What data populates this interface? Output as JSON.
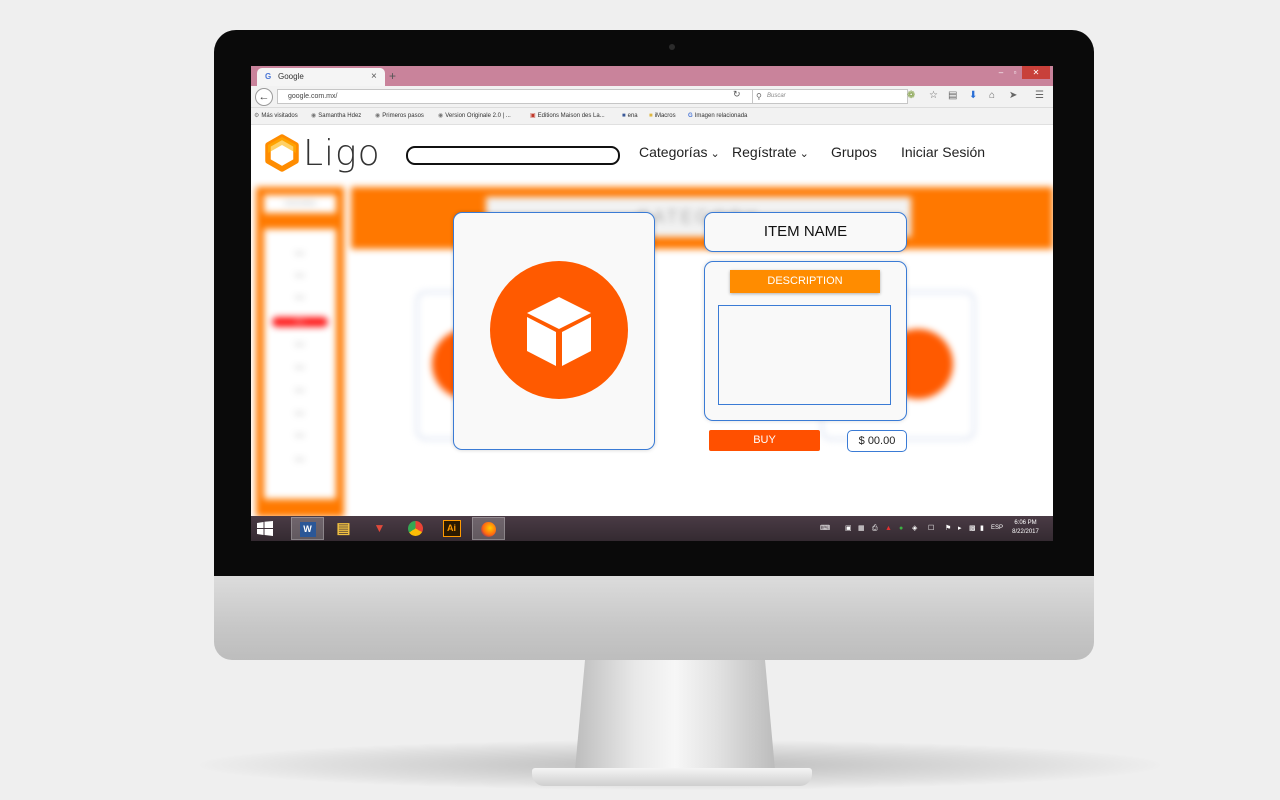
{
  "browser": {
    "tab_title": "Google",
    "tab_favicon": "G",
    "close_tab": "×",
    "new_tab": "+",
    "window_controls": [
      "–",
      "▫",
      "✕"
    ],
    "url": "google.com.mx/",
    "search_placeholder": "Buscar",
    "bookmarks": [
      {
        "label": "Más visitados",
        "icon": "gear-icon"
      },
      {
        "label": "Samantha Hdez",
        "icon": "globe-icon"
      },
      {
        "label": "Primeros pasos",
        "icon": "globe-icon"
      },
      {
        "label": "Version Originale 2.0 | ...",
        "icon": "globe-icon"
      },
      {
        "label": "Editions Maison des La...",
        "icon": "site-icon"
      },
      {
        "label": "ena",
        "icon": "facebook-icon"
      },
      {
        "label": "iMacros",
        "icon": "folder-icon"
      },
      {
        "label": "Imagen relacionada",
        "icon": "google-icon"
      }
    ]
  },
  "site": {
    "logo_text": "Ligo",
    "nav": {
      "categorias": "Categorías",
      "registrate": "Regístrate",
      "grupos": "Grupos",
      "iniciar_sesion": "Iniciar Sesión"
    },
    "item": {
      "name": "ITEM NAME",
      "description_label": "DESCRIPTION",
      "description_value": "",
      "buy_label": "BUY",
      "price": "$ 00.00"
    },
    "background": {
      "sidebar_header": "CATEGORIES",
      "banner_title": "CATEGORY",
      "sidebar_items": [
        "Item",
        "Item",
        "Item",
        "Item",
        "Item",
        "Item",
        "Item",
        "Item",
        "Item",
        "Item"
      ]
    }
  },
  "taskbar": {
    "apps": [
      {
        "name": "word",
        "glyph": "W",
        "color": "#2b5797"
      },
      {
        "name": "file-explorer",
        "glyph": "▤",
        "color": "#f0c040"
      },
      {
        "name": "popcorn",
        "glyph": "▼",
        "color": "#d0342c"
      },
      {
        "name": "chrome",
        "glyph": "◉",
        "color": "#34a853"
      },
      {
        "name": "illustrator",
        "glyph": "Ai",
        "color": "#ff9a00"
      },
      {
        "name": "firefox",
        "glyph": "●",
        "color": "#ff6611"
      }
    ],
    "language": "ESP",
    "time": "6:06 PM",
    "date": "8/22/2017"
  },
  "colors": {
    "accent_orange": "#ff5a00",
    "banner_orange": "#ff7800",
    "description_orange": "#ff8c00",
    "border_blue": "#3a7bd5",
    "tab_bar_pink": "#c9839b"
  }
}
